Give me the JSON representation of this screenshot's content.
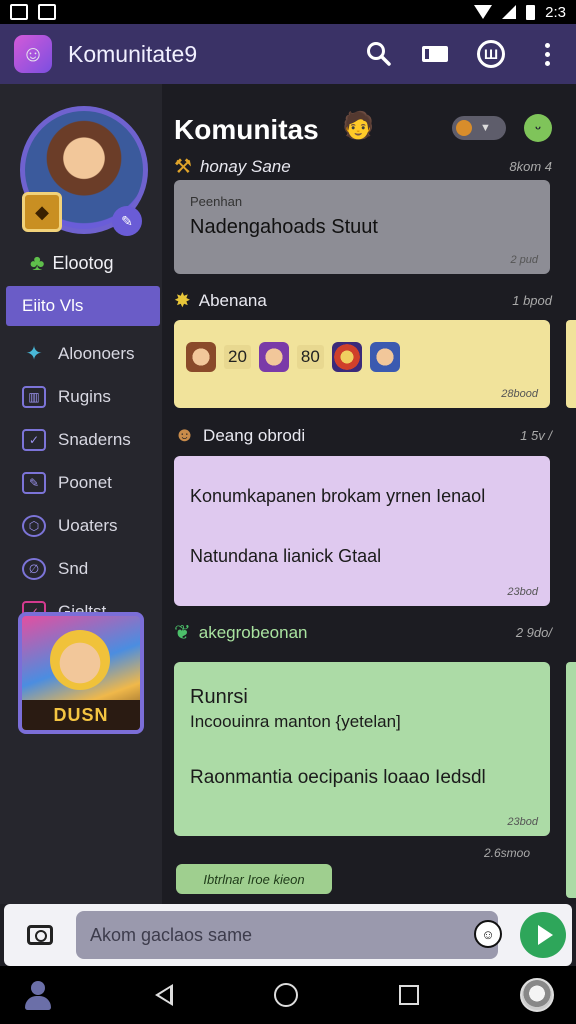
{
  "status_bar": {
    "time": "2:3"
  },
  "app_bar": {
    "title": "Komunitate9"
  },
  "sidebar": {
    "profile_name": "Elootog",
    "nav_items": [
      {
        "label": "Eiito Vls"
      },
      {
        "label": "Aloonoers"
      },
      {
        "label": "Rugins"
      },
      {
        "label": "Snaderns"
      },
      {
        "label": "Poonet"
      },
      {
        "label": "Uoaters"
      },
      {
        "label": "Snd"
      },
      {
        "label": "Gieltst"
      }
    ],
    "game_card_label": "DUSN"
  },
  "feed": {
    "title": "Komunitas",
    "posts": [
      {
        "author": "honay Sane",
        "time": "8kom 4",
        "small_text": "Peenhan",
        "text": "Nadengahoads Stuut",
        "meta": "2 pud"
      },
      {
        "author": "Abenana",
        "time": "1 bpod",
        "score1": "20",
        "score2": "80",
        "meta": "28bood"
      },
      {
        "author": "Deang obrodi",
        "time": "1 5v /",
        "text1": "Konumkapanen brokam yrnen Ienaol",
        "text2": "Natundana lianick Gtaal",
        "meta": "23bod"
      },
      {
        "author": "akegrobeonan",
        "time": "2 9do/",
        "text1": "Runrsi",
        "text2": "Incoouinra manton {yetelan]",
        "text3": "Raonmantia oecipanis loaao Iedsdl",
        "meta": "23bod"
      }
    ],
    "bottom_time": "2.6smoo",
    "mini_pill": "Ibtrlnar Iroe kieon"
  },
  "composer": {
    "placeholder": "Akom gaclaos same"
  }
}
